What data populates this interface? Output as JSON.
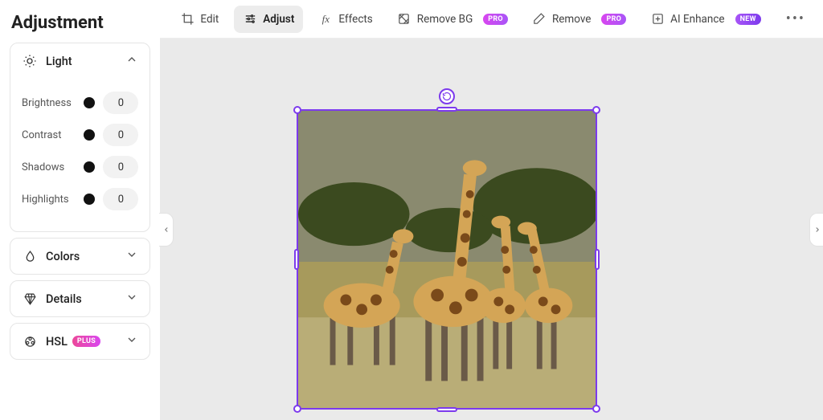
{
  "sidebar": {
    "title": "Adjustment",
    "panels": {
      "light": {
        "label": "Light",
        "expanded": true,
        "sliders": [
          {
            "label": "Brightness",
            "value": 0
          },
          {
            "label": "Contrast",
            "value": 0
          },
          {
            "label": "Shadows",
            "value": 0
          },
          {
            "label": "Highlights",
            "value": 0
          }
        ]
      },
      "colors": {
        "label": "Colors",
        "expanded": false
      },
      "details": {
        "label": "Details",
        "expanded": false
      },
      "hsl": {
        "label": "HSL",
        "badge": "PLUS",
        "expanded": false
      }
    }
  },
  "toolbar": {
    "items": [
      {
        "id": "edit",
        "label": "Edit"
      },
      {
        "id": "adjust",
        "label": "Adjust",
        "active": true
      },
      {
        "id": "effects",
        "label": "Effects"
      },
      {
        "id": "removebg",
        "label": "Remove BG",
        "badge": "PRO"
      },
      {
        "id": "remove",
        "label": "Remove",
        "badge": "PRO"
      },
      {
        "id": "aienhance",
        "label": "AI Enhance",
        "badge": "NEW"
      }
    ]
  },
  "colors": {
    "accent": "#7c3aed"
  }
}
